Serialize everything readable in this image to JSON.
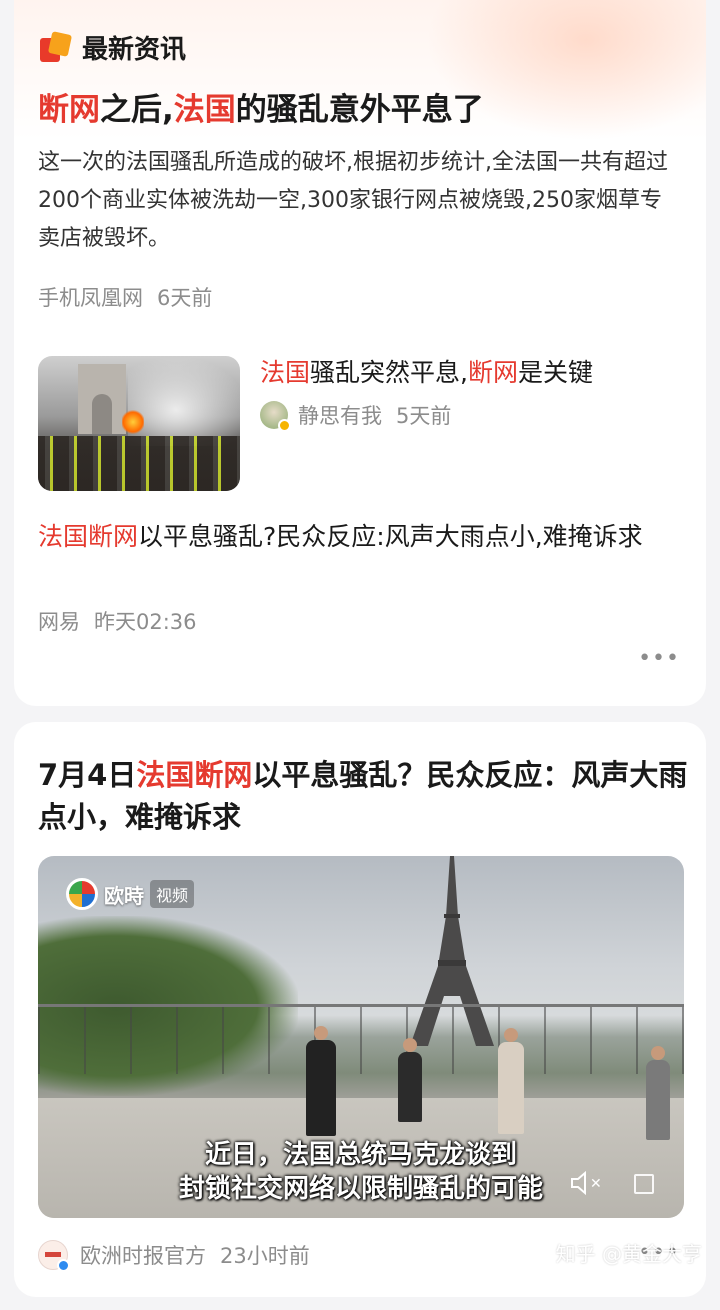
{
  "header": {
    "title": "最新资讯"
  },
  "lead": {
    "headline": [
      {
        "text": "断网",
        "highlight": true
      },
      {
        "text": "之后,",
        "highlight": false
      },
      {
        "text": "法国",
        "highlight": true
      },
      {
        "text": "的骚乱意外平息了",
        "highlight": false
      }
    ],
    "summary": "这一次的法国骚乱所造成的破坏,根据初步统计,全法国一共有超过200个商业实体被洗劫一空,300家银行网点被烧毁,250家烟草专卖店被毁坏。",
    "source": "手机凤凰网",
    "time": "6天前"
  },
  "related": {
    "title": [
      {
        "text": "法国",
        "highlight": true
      },
      {
        "text": "骚乱突然平息,",
        "highlight": false
      },
      {
        "text": "断网",
        "highlight": true
      },
      {
        "text": "是关键",
        "highlight": false
      }
    ],
    "author": "静思有我",
    "time": "5天前"
  },
  "item3": {
    "title": [
      {
        "text": "法国断网",
        "highlight": true
      },
      {
        "text": "以平息骚乱?民众反应:风声大雨点小,难掩诉求",
        "highlight": false
      }
    ],
    "source": "网易",
    "time": "昨天02:36"
  },
  "more_label": "•••",
  "video_card": {
    "title": [
      {
        "text": "7月4日",
        "highlight": false
      },
      {
        "text": "法国断网",
        "highlight": true
      },
      {
        "text": "以平息骚乱？民众反应：风声大雨点小，难掩诉求",
        "highlight": false
      }
    ],
    "brand": "欧時",
    "brand_tag": "视频",
    "subtitle_1": "近日，法国总统马克龙谈到",
    "subtitle_2": "封锁社交网络以限制骚乱的可能",
    "mute_icon": "✕",
    "author": "欧洲时报官方",
    "time": "23小时前"
  },
  "watermark": "知乎 @黄金大亨",
  "colors": {
    "highlight": "#e53a2f",
    "meta": "#8c8c8c"
  }
}
